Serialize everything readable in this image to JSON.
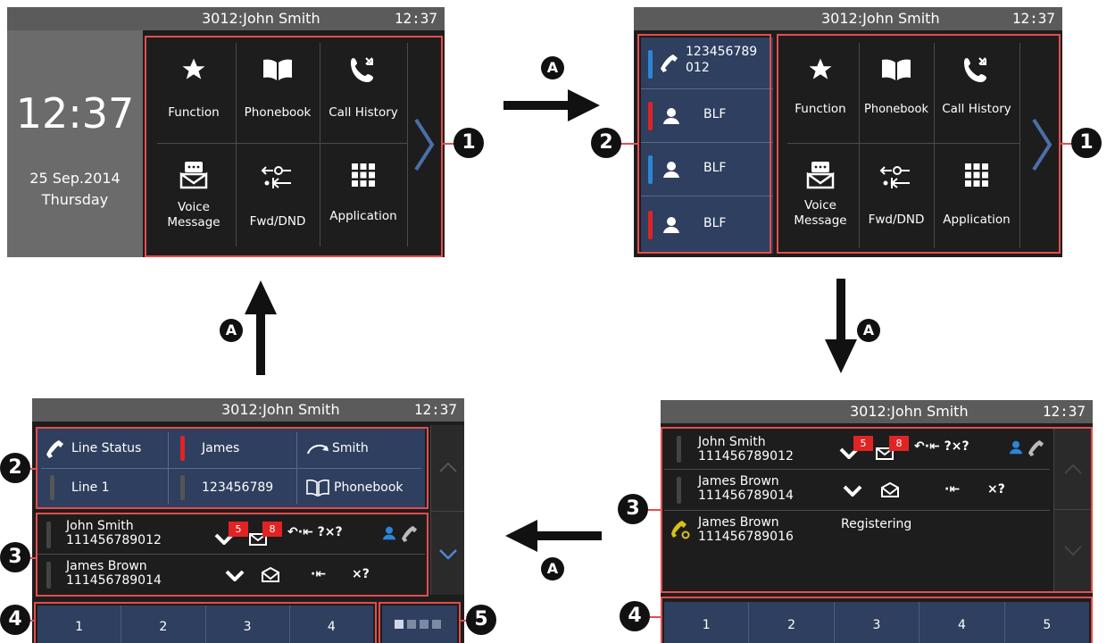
{
  "screens": {
    "top_left": {
      "status_user": "3012:John Smith",
      "status_time": "12:37",
      "clock_time": "12:37",
      "date": "25 Sep.2014",
      "weekday": "Thursday",
      "tiles": [
        "Function",
        "Phonebook",
        "Call History",
        "Voice Message",
        "Fwd/DND",
        "Application"
      ],
      "tile_voice_line1": "Voice",
      "tile_voice_line2": "Message"
    },
    "top_right": {
      "status_user": "3012:John Smith",
      "status_time": "12:37",
      "blf_rows": [
        {
          "line1": "123456789",
          "line2": "012",
          "icon": "handset-icon",
          "led": "#2a86d6"
        },
        {
          "line1": "BLF",
          "icon": "person-icon",
          "led": "#e02424"
        },
        {
          "line1": "BLF",
          "icon": "person-icon",
          "led": "#2a86d6"
        },
        {
          "line1": "BLF",
          "icon": "person-icon",
          "led": "#e02424"
        }
      ],
      "tiles": [
        "Function",
        "Phonebook",
        "Call History",
        "Fwd/DND",
        "Application"
      ],
      "tile_voice_line1": "Voice",
      "tile_voice_line2": "Message"
    },
    "bottom_left": {
      "status_user": "3012:John Smith",
      "status_time": "12:37",
      "keys": [
        {
          "label": "Line Status",
          "icon": "handset-icon",
          "led": ""
        },
        {
          "label": "James",
          "icon": "",
          "led": "#e02424"
        },
        {
          "label": "Smith",
          "icon": "transfer-icon",
          "led": ""
        },
        {
          "label": "Line 1",
          "icon": "",
          "led": "#555555"
        },
        {
          "label": "123456789",
          "icon": "",
          "led": "#555555"
        },
        {
          "label": "Phonebook",
          "icon": "book-icon",
          "led": ""
        }
      ],
      "lines": [
        {
          "name": "John Smith",
          "number": "111456789012",
          "missed": "5",
          "voicemail": "8"
        },
        {
          "name": "James Brown",
          "number": "111456789014"
        }
      ],
      "fkeys": [
        "1",
        "2",
        "3",
        "4"
      ]
    },
    "bottom_right": {
      "status_user": "3012:John Smith",
      "status_time": "12:37",
      "lines": [
        {
          "name": "John Smith",
          "number": "111456789012",
          "missed": "5",
          "voicemail": "8"
        },
        {
          "name": "James Brown",
          "number": "111456789014"
        },
        {
          "name": "James Brown",
          "number": "111456789016",
          "status": "Registering"
        }
      ],
      "fkeys": [
        "1",
        "2",
        "3",
        "4",
        "5"
      ]
    }
  },
  "callouts": {
    "one": "1",
    "two": "2",
    "three": "3",
    "four": "4",
    "five": "5",
    "a": "A"
  },
  "colors": {
    "highlight_box": "#e74c4c",
    "status_bar": "#5b5b5b",
    "screen_bg": "#1d1d1d",
    "blue_panel": "#2e3f5f"
  }
}
